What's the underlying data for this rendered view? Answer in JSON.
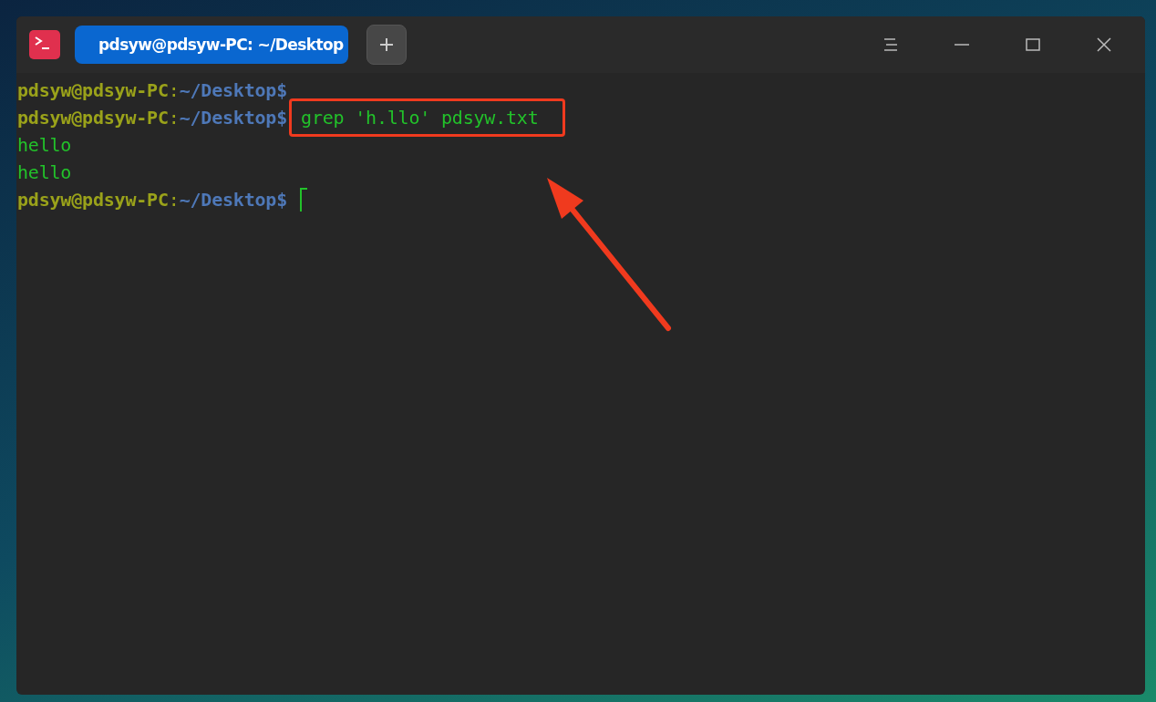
{
  "tab": {
    "title": "pdsyw@pdsyw-PC: ~/Desktop",
    "selected": true
  },
  "terminal": {
    "lines": [
      {
        "kind": "prompt",
        "user": "pdsyw@pdsyw-PC",
        "separator": ":",
        "path": "~/Desktop",
        "symbol": "$"
      },
      {
        "kind": "prompt",
        "user": "pdsyw@pdsyw-PC",
        "separator": ":",
        "path": "~/Desktop",
        "symbol": "$",
        "command": "grep 'h.llo' pdsyw.txt",
        "highlighted": true
      },
      {
        "kind": "output",
        "text": "hello"
      },
      {
        "kind": "output",
        "text": "hello"
      },
      {
        "kind": "prompt",
        "user": "pdsyw@pdsyw-PC",
        "separator": ":",
        "path": "~/Desktop",
        "symbol": "$",
        "cursor": true
      }
    ]
  }
}
